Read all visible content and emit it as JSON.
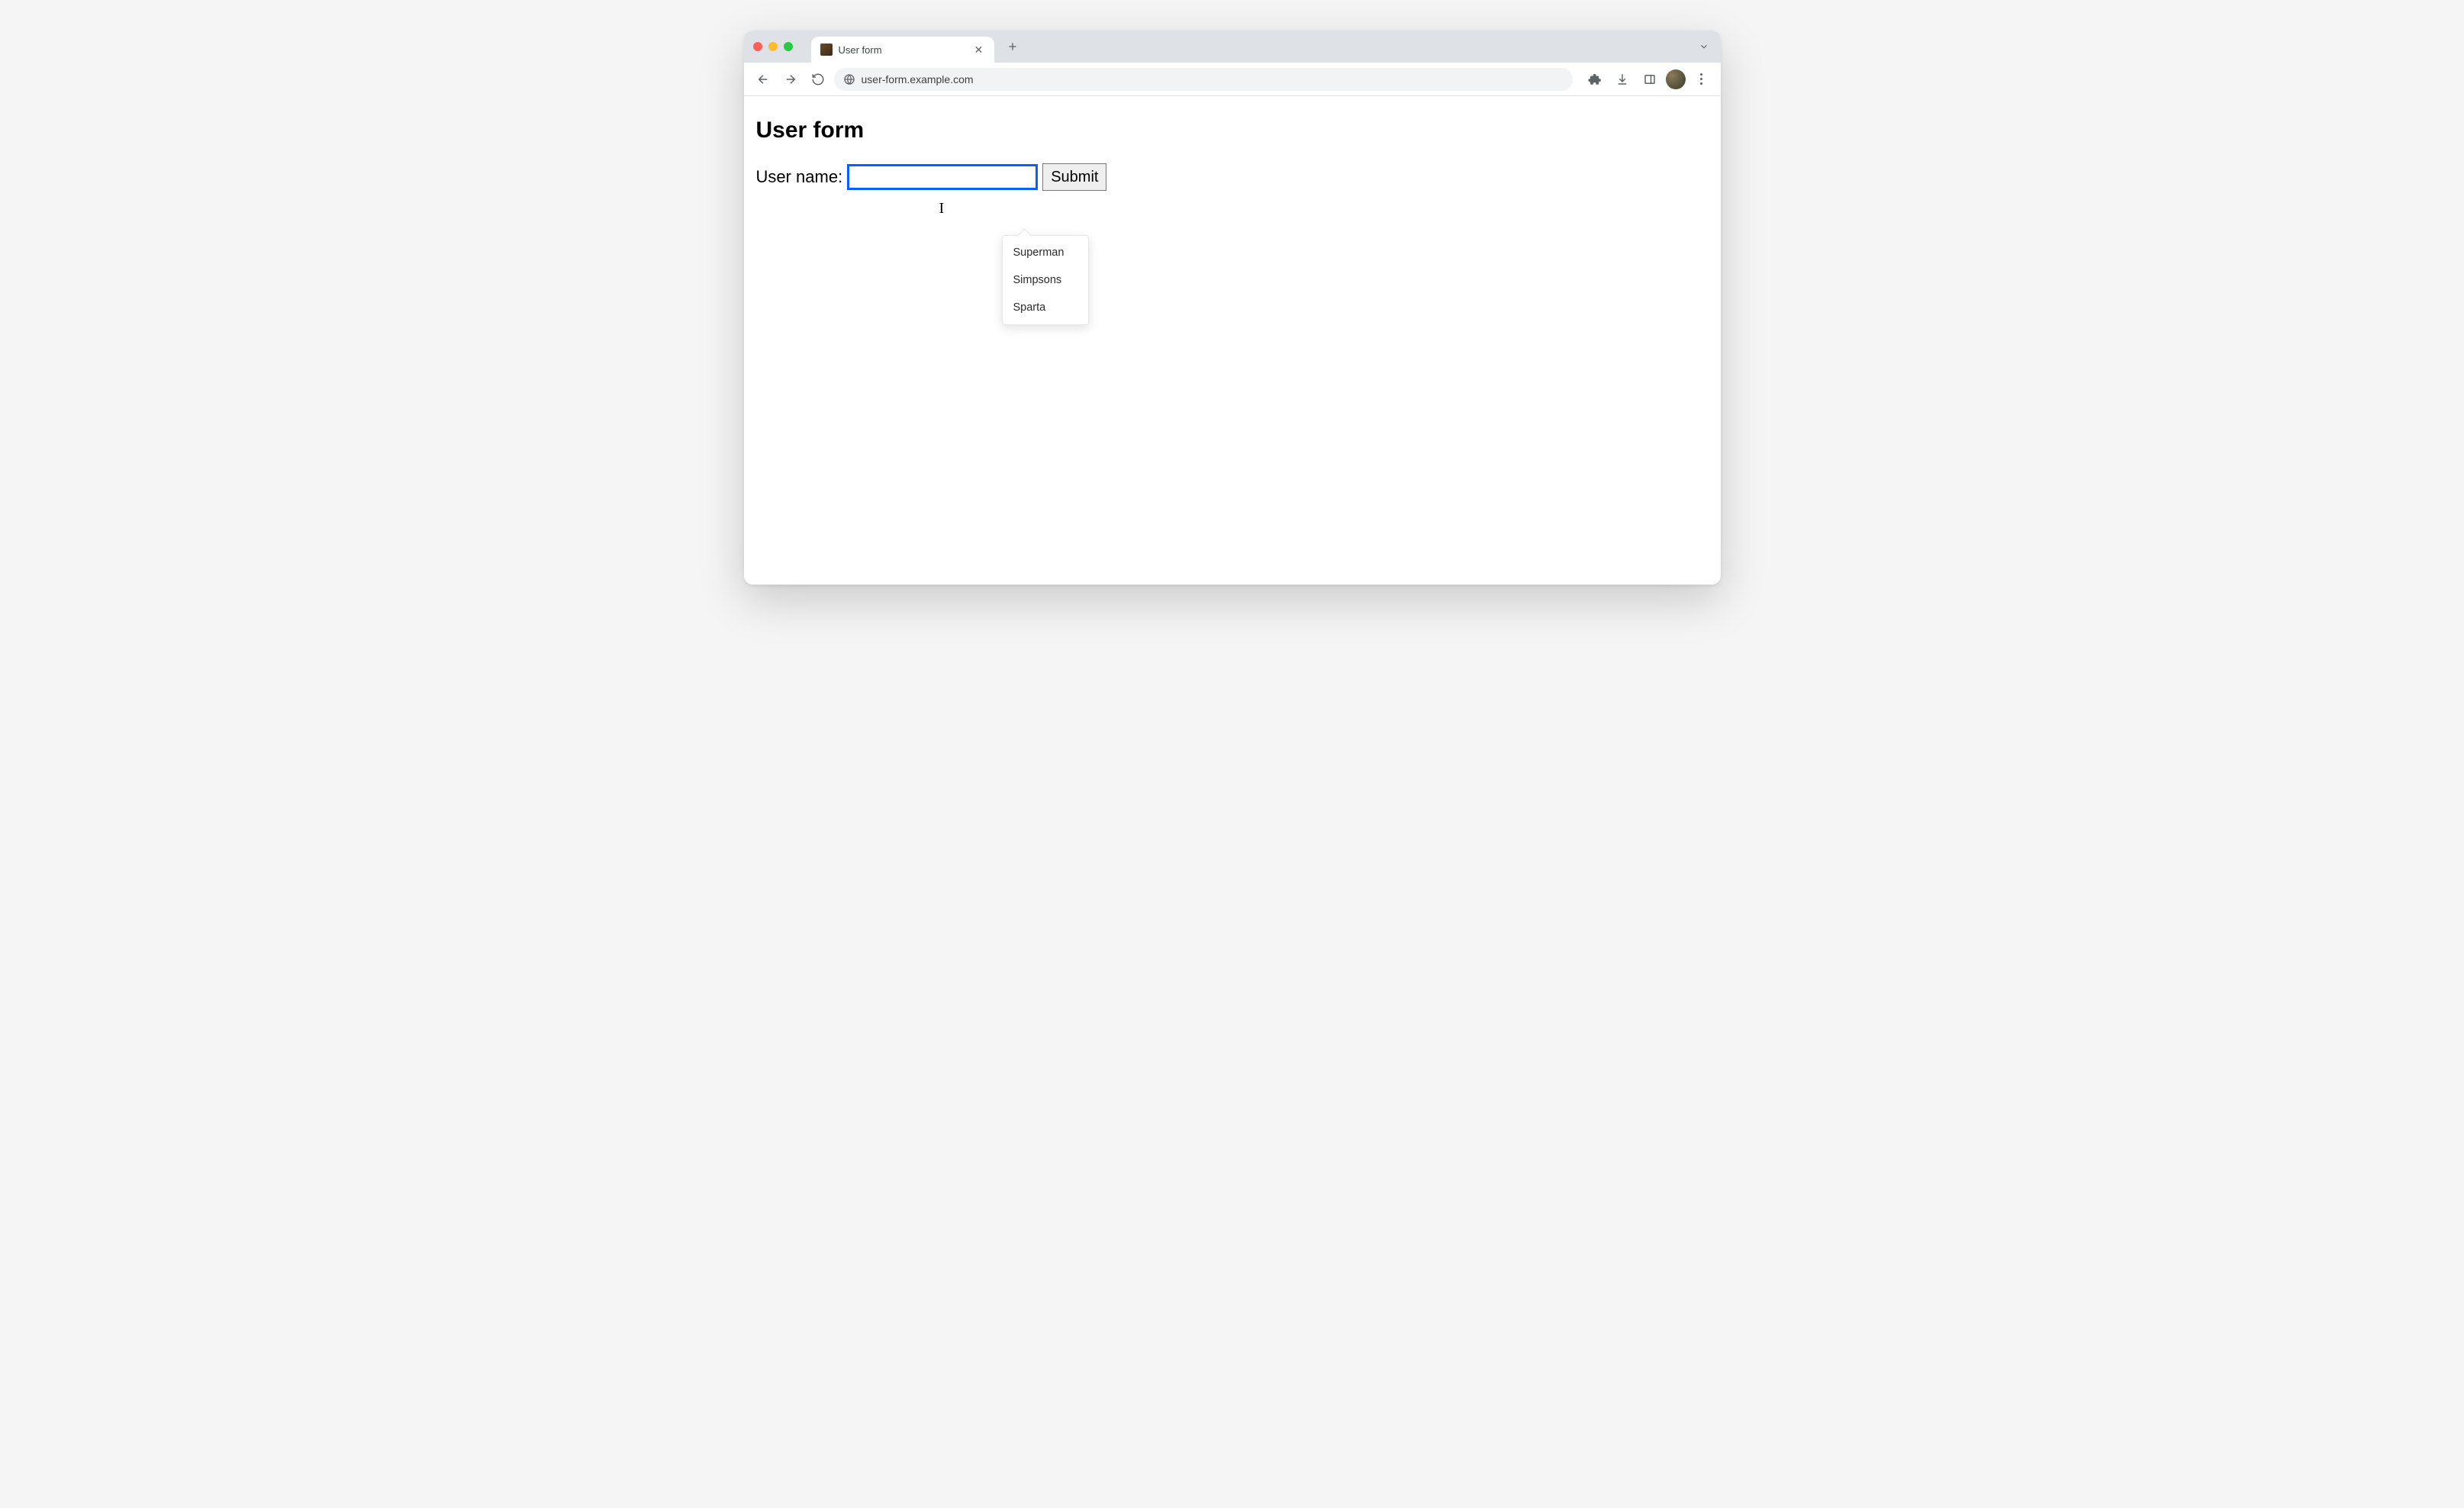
{
  "browser": {
    "tab_title": "User form",
    "url": "user-form.example.com"
  },
  "page": {
    "heading": "User form",
    "label_username": "User name:",
    "username_value": "",
    "submit_label": "Submit"
  },
  "autocomplete": {
    "items": [
      "Superman",
      "Simpsons",
      "Sparta"
    ]
  }
}
